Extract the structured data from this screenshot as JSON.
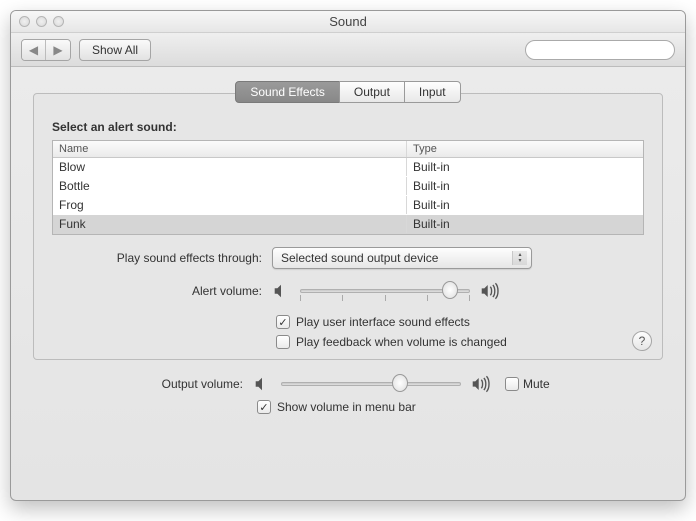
{
  "window": {
    "title": "Sound"
  },
  "toolbar": {
    "show_all": "Show All",
    "search_placeholder": ""
  },
  "tabs": [
    {
      "label": "Sound Effects",
      "active": true
    },
    {
      "label": "Output",
      "active": false
    },
    {
      "label": "Input",
      "active": false
    }
  ],
  "alerts": {
    "heading": "Select an alert sound:",
    "columns": {
      "name": "Name",
      "type": "Type"
    },
    "rows": [
      {
        "name": "Blow",
        "type": "Built-in",
        "selected": false
      },
      {
        "name": "Bottle",
        "type": "Built-in",
        "selected": false
      },
      {
        "name": "Frog",
        "type": "Built-in",
        "selected": false
      },
      {
        "name": "Funk",
        "type": "Built-in",
        "selected": true
      }
    ]
  },
  "effects": {
    "through_label": "Play sound effects through:",
    "through_value": "Selected sound output device",
    "alert_volume_label": "Alert volume:",
    "alert_volume_pct": 88,
    "play_ui_label": "Play user interface sound effects",
    "play_ui_checked": true,
    "feedback_label": "Play feedback when volume is changed",
    "feedback_checked": false
  },
  "output": {
    "volume_label": "Output volume:",
    "volume_pct": 66,
    "mute_label": "Mute",
    "mute_checked": false,
    "menubar_label": "Show volume in menu bar",
    "menubar_checked": true
  },
  "help_glyph": "?"
}
